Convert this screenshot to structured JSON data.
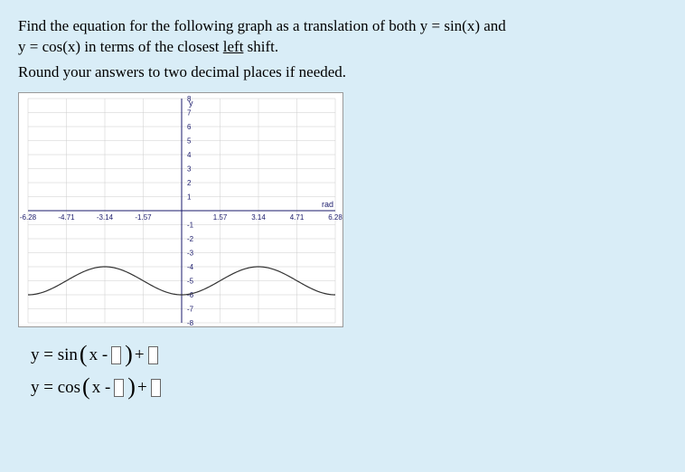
{
  "question": {
    "line1_a": "Find the equation for the following graph as a translation of both y = sin(x) and",
    "line1_b_pre": "y = cos(x) in terms of the closest ",
    "line1_b_underline": "left",
    "line1_b_post": " shift.",
    "instruction": "Round your answers to two decimal places if needed."
  },
  "equation1": {
    "pre": "y = sin",
    "open": "(",
    "x_minus": "x - ",
    "close": ")",
    "plus": " + "
  },
  "equation2": {
    "pre": "y = cos",
    "open": "(",
    "x_minus": "x - ",
    "close": ")",
    "plus": " + "
  },
  "chart_data": {
    "type": "line",
    "title": "",
    "xlabel": "rad",
    "ylabel": "y",
    "xlim": [
      -6.28,
      6.28
    ],
    "ylim": [
      -8,
      8
    ],
    "x_ticks": [
      -6.28,
      -4.71,
      -3.14,
      -1.57,
      0,
      1.57,
      3.14,
      4.71,
      6.28
    ],
    "y_ticks": [
      -8,
      -7,
      -6,
      -5,
      -4,
      -3,
      -2,
      -1,
      0,
      1,
      2,
      3,
      4,
      5,
      6,
      7,
      8
    ],
    "series": [
      {
        "name": "curve",
        "description": "sinusoid, amplitude 1, period 2π, vertical shift -5; peaks at x≈-3.14 and x≈3.14 with y≈-4, troughs at x≈0 and x≈±6.28 with y≈-6",
        "x": [
          -6.28,
          -5.5,
          -4.71,
          -3.93,
          -3.14,
          -2.36,
          -1.57,
          -0.79,
          0.0,
          0.79,
          1.57,
          2.36,
          3.14,
          3.93,
          4.71,
          5.5,
          6.28
        ],
        "y": [
          -6.0,
          -5.71,
          -5.0,
          -4.29,
          -4.0,
          -4.29,
          -5.0,
          -5.71,
          -6.0,
          -5.71,
          -5.0,
          -4.29,
          -4.0,
          -4.29,
          -5.0,
          -5.71,
          -6.0
        ]
      }
    ]
  }
}
